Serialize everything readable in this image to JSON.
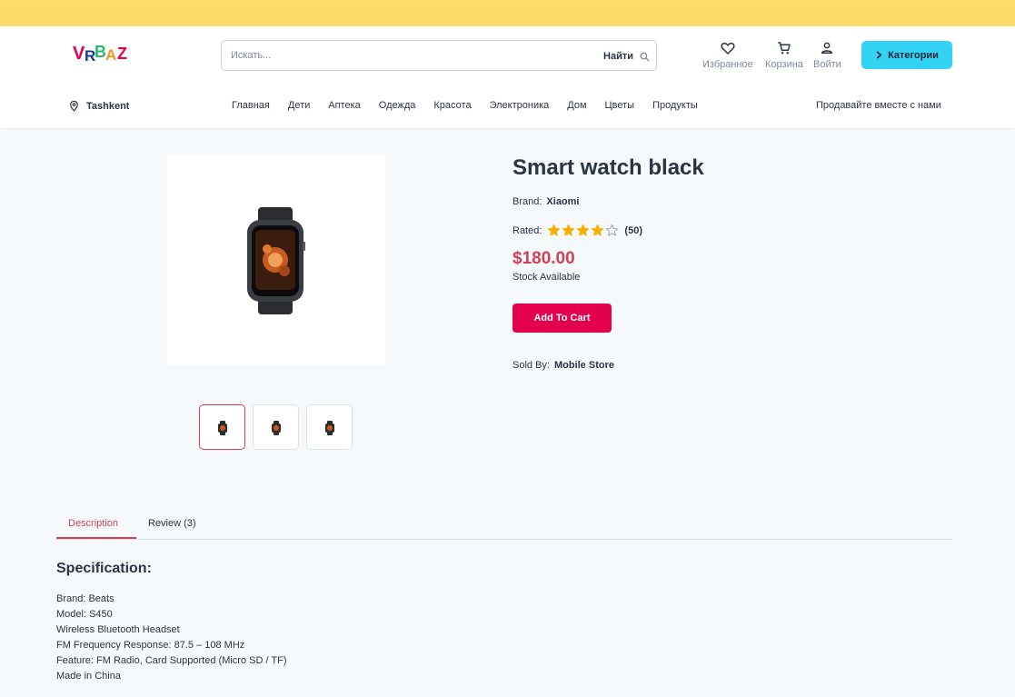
{
  "header": {
    "logo_text": "VRBAZ",
    "search": {
      "placeholder": "Искать...",
      "button_label": "Найти"
    },
    "actions": {
      "favorites": "Избранное",
      "cart": "Корзина",
      "login": "Войти"
    },
    "categories_button": "Категории",
    "location": "Tashkent",
    "nav": [
      "Главная",
      "Дети",
      "Аптека",
      "Одежда",
      "Красота",
      "Электроника",
      "Дом",
      "Цветы",
      "Продукты"
    ],
    "sell_link": "Продавайте вместе с нами"
  },
  "product": {
    "title": "Smart watch black",
    "brand_label": "Brand:",
    "brand": "Xiaomi",
    "rated_label": "Rated:",
    "rating": 4,
    "rating_max": 5,
    "rating_count": "(50)",
    "price": "$180.00",
    "stock": "Stock Available",
    "add_to_cart": "Add To Cart",
    "sold_by_label": "Sold By:",
    "sold_by": "Mobile Store",
    "thumbnails_count": 3,
    "active_thumbnail": 0
  },
  "tabs": [
    {
      "label": "Description",
      "active": true
    },
    {
      "label": "Review (3)",
      "active": false
    }
  ],
  "specification": {
    "title": "Specification:",
    "lines": [
      "Brand: Beats",
      "Model: S450",
      "Wireless Bluetooth Headset",
      "FM Frequency Response: 87.5 – 108 MHz",
      "Feature: FM Radio, Card Supported (Micro SD / TF)",
      "Made in China"
    ]
  },
  "colors": {
    "topbar": "#fedb6b",
    "accent": "#d23f57",
    "button": "#e3004c",
    "categories": "#33d3f4",
    "star": "#faaf00"
  },
  "icons": [
    "pin-icon",
    "search-icon",
    "heart-icon",
    "cart-icon",
    "user-icon",
    "chevron-right-icon",
    "star-icon"
  ]
}
